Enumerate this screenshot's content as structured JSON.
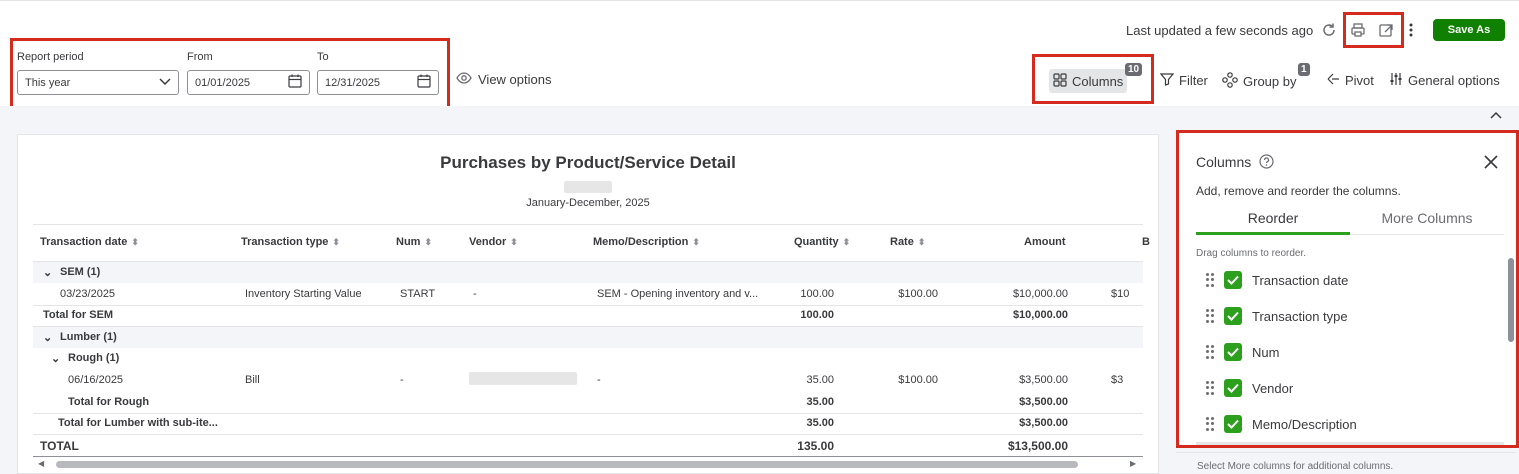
{
  "header": {
    "last_updated": "Last updated a few seconds ago",
    "save_as_label": "Save As",
    "icons": [
      "refresh-icon",
      "print-icon",
      "export-icon",
      "more-icon"
    ]
  },
  "report_period": {
    "label": "Report period",
    "value": "This year",
    "from_label": "From",
    "from_value": "01/01/2025",
    "to_label": "To",
    "to_value": "12/31/2025",
    "view_options": "View options"
  },
  "toolbar": {
    "columns_label": "Columns",
    "columns_count": "10",
    "filter_label": "Filter",
    "group_by_label": "Group by",
    "group_by_count": "1",
    "pivot_label": "Pivot",
    "general_options_label": "General options"
  },
  "report": {
    "title": "Purchases by Product/Service Detail",
    "date_range": "January-December, 2025",
    "columns": [
      "Transaction date",
      "Transaction type",
      "Num",
      "Vendor",
      "Memo/Description",
      "Quantity",
      "Rate",
      "Amount",
      "B"
    ],
    "rows": [
      {
        "kind": "group",
        "label": "SEM (1)"
      },
      {
        "kind": "data",
        "date": "03/23/2025",
        "type": "Inventory Starting Value",
        "num": "START",
        "vendor": "-",
        "memo": "SEM - Opening inventory and v...",
        "qty": "100.00",
        "rate": "$100.00",
        "amount": "$10,000.00",
        "extra": "$10"
      },
      {
        "kind": "total",
        "label": "Total for SEM",
        "qty": "100.00",
        "amount": "$10,000.00"
      },
      {
        "kind": "group",
        "label": "Lumber (1)"
      },
      {
        "kind": "subgroup",
        "label": "Rough (1)"
      },
      {
        "kind": "data2",
        "date": "06/16/2025",
        "type": "Bill",
        "num": "-",
        "memo": "-",
        "qty": "35.00",
        "rate": "$100.00",
        "amount": "$3,500.00",
        "extra": "$3"
      },
      {
        "kind": "subtotal",
        "label": "Total for Rough",
        "qty": "35.00",
        "amount": "$3,500.00"
      },
      {
        "kind": "subtotal",
        "label": "Total for Lumber with sub-ite...",
        "qty": "35.00",
        "amount": "$3,500.00"
      },
      {
        "kind": "grand",
        "label": "TOTAL",
        "qty": "135.00",
        "amount": "$13,500.00"
      }
    ]
  },
  "columns_panel": {
    "title": "Columns",
    "description": "Add, remove and reorder the columns.",
    "tab_reorder": "Reorder",
    "tab_more": "More Columns",
    "drag_hint": "Drag columns to reorder.",
    "items": [
      "Transaction date",
      "Transaction type",
      "Num",
      "Vendor",
      "Memo/Description"
    ],
    "footer": "Select More columns for additional columns."
  },
  "colors": {
    "accent_green": "#2ca01c",
    "save_green": "#108000",
    "highlight_red": "#d52b1e"
  }
}
